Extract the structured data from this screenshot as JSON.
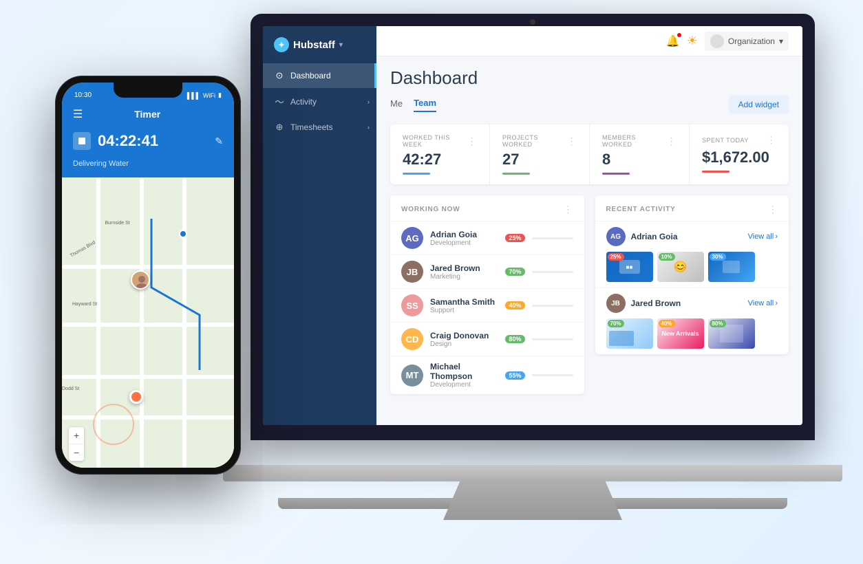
{
  "app": {
    "name": "Hubstaff",
    "logo_text": "Hubstaff"
  },
  "sidebar": {
    "items": [
      {
        "id": "dashboard",
        "label": "Dashboard",
        "icon": "⊙",
        "active": true
      },
      {
        "id": "activity",
        "label": "Activity",
        "icon": "〜",
        "active": false,
        "has_chevron": true
      },
      {
        "id": "timesheets",
        "label": "Timesheets",
        "icon": "⊕",
        "active": false,
        "has_chevron": true
      }
    ]
  },
  "topbar": {
    "org_label": "Organization",
    "chevron": "▾"
  },
  "dashboard": {
    "title": "Dashboard",
    "tabs": [
      {
        "id": "me",
        "label": "Me",
        "active": false
      },
      {
        "id": "team",
        "label": "Team",
        "active": true
      }
    ],
    "add_widget_label": "Add widget"
  },
  "stats": [
    {
      "id": "worked-this-week",
      "label": "WORKED THIS WEEK",
      "value": "42:27",
      "bar_color": "#42a5f5"
    },
    {
      "id": "projects-worked",
      "label": "PROJECTS WORKED",
      "value": "27",
      "bar_color": "#66bb6a"
    },
    {
      "id": "members-worked",
      "label": "MEMBERS WORKED",
      "value": "8",
      "bar_color": "#ab47bc"
    },
    {
      "id": "spent-today",
      "label": "SPENT TODAY",
      "value": "$1,672.00",
      "bar_color": "#ef5350"
    }
  ],
  "working_now": {
    "title": "WORKING NOW",
    "members": [
      {
        "name": "Adrian Goia",
        "role": "Development",
        "badge": "25%",
        "badge_color": "#ef5350",
        "avatar_color": "#5c6bc0",
        "avatar_initials": "AG"
      },
      {
        "name": "Jared Brown",
        "role": "Marketing",
        "badge": "70%",
        "badge_color": "#66bb6a",
        "avatar_color": "#8d6e63",
        "avatar_initials": "JB"
      },
      {
        "name": "Samantha Smith",
        "role": "Support",
        "badge": "40%",
        "badge_color": "#ffa726",
        "avatar_color": "#ef9a9a",
        "avatar_initials": "SS"
      },
      {
        "name": "Craig Donovan",
        "role": "Design",
        "badge": "80%",
        "badge_color": "#66bb6a",
        "avatar_color": "#ffb74d",
        "avatar_initials": "CD"
      },
      {
        "name": "Michael Thompson",
        "role": "Development",
        "badge": "55%",
        "badge_color": "#42a5f5",
        "avatar_color": "#78909c",
        "avatar_initials": "MT"
      }
    ]
  },
  "recent_activity": {
    "title": "RECENT ACTIVITY",
    "view_all_label": "View all",
    "people": [
      {
        "name": "Adrian Goia",
        "avatar_color": "#5c6bc0",
        "avatar_initials": "AG",
        "thumbnails": [
          {
            "bg": "linear-gradient(135deg, #1976d2, #42a5f5)",
            "badge": "25%",
            "badge_color": "#ef5350"
          },
          {
            "bg": "linear-gradient(135deg, #f5f5f5, #e0e0e0)",
            "badge": "10%",
            "badge_color": "#66bb6a"
          },
          {
            "bg": "linear-gradient(135deg, #e3f2fd, #90caf9)",
            "badge": "30%",
            "badge_color": "#42a5f5"
          }
        ]
      },
      {
        "name": "Jared Brown",
        "avatar_color": "#8d6e63",
        "avatar_initials": "JB",
        "thumbnails": [
          {
            "bg": "linear-gradient(135deg, #e8f5e9, #a5d6a7)",
            "badge": "70%",
            "badge_color": "#66bb6a"
          },
          {
            "bg": "linear-gradient(135deg, #fce4ec, #f48fb1)",
            "badge": "40%",
            "badge_color": "#ffa726"
          },
          {
            "bg": "linear-gradient(135deg, #e3f2fd, #64b5f6)",
            "badge": "80%",
            "badge_color": "#66bb6a"
          }
        ]
      }
    ]
  },
  "phone": {
    "time": "10:30",
    "signal": "▌▌▌",
    "wifi": "WiFi",
    "battery": "🔋",
    "header_title": "Timer",
    "timer_value": "04:22:41",
    "task_label": "Delivering Water",
    "zoom_plus": "+",
    "zoom_minus": "−"
  }
}
